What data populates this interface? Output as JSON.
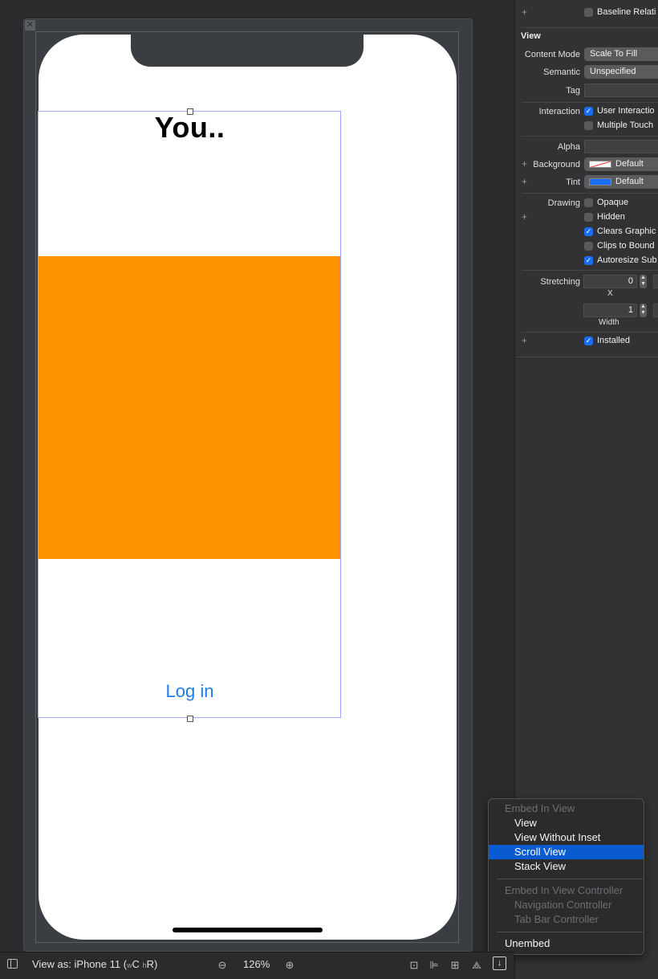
{
  "scene": {
    "title_label": "You..",
    "login_button": "Log in",
    "close_icon": "x-icon",
    "colors": {
      "orange_view": "#ff9300",
      "login_text": "#1f7ee6"
    }
  },
  "inspector": {
    "top_partial_checkbox": "Baseline Relati",
    "section_title": "View",
    "content_mode": {
      "label": "Content Mode",
      "value": "Scale To Fill"
    },
    "semantic": {
      "label": "Semantic",
      "value": "Unspecified"
    },
    "tag": {
      "label": "Tag",
      "value": ""
    },
    "interaction": {
      "label": "Interaction",
      "user_interaction": "User Interactio",
      "multiple_touch": "Multiple Touch"
    },
    "alpha": {
      "label": "Alpha",
      "value": ""
    },
    "background": {
      "label": "Background",
      "value": "Default"
    },
    "tint": {
      "label": "Tint",
      "value": "Default"
    },
    "drawing": {
      "label": "Drawing",
      "opaque": "Opaque",
      "hidden": "Hidden",
      "clears_graphics": "Clears Graphic",
      "clips_to_bounds": "Clips to Bound",
      "autoresize": "Autoresize Sub"
    },
    "stretching": {
      "label": "Stretching",
      "x_value": "0",
      "x_label": "X",
      "width_value": "1",
      "width_label": "Width"
    },
    "installed": "Installed",
    "plus": "+"
  },
  "menu": {
    "header_embed_view": "Embed In View",
    "view": "View",
    "view_without_inset": "View Without Inset",
    "scroll_view": "Scroll View",
    "stack_view": "Stack View",
    "header_embed_controller": "Embed In View Controller",
    "navigation_controller": "Navigation Controller",
    "tab_bar_controller": "Tab Bar Controller",
    "unembed": "Unembed"
  },
  "bottombar": {
    "view_as_prefix": "View as: iPhone 11 (",
    "w_sub": "w",
    "c": "C",
    "h_sub": "h",
    "r": "R",
    "suffix": ")",
    "zoom": "126%",
    "zoom_out_icon": "magnifier-minus-icon",
    "zoom_in_icon": "magnifier-plus-icon"
  }
}
